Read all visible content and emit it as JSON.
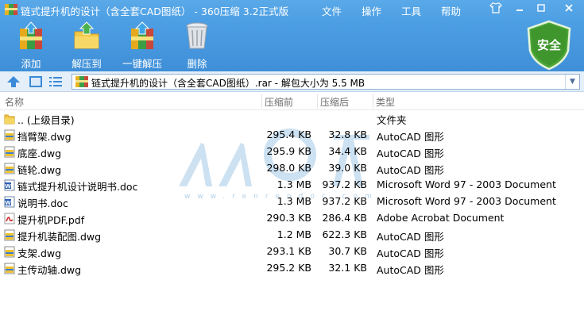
{
  "window": {
    "title": "链式提升机的设计（含全套CAD图纸） - 360压缩 3.2正式版",
    "controls": [
      "shirt-icon",
      "minimize-icon",
      "maximize-icon",
      "close-icon"
    ]
  },
  "menu": {
    "file": "文件",
    "operate": "操作",
    "tools": "工具",
    "help": "帮助"
  },
  "toolbar": {
    "add": "添加",
    "extract": "解压到",
    "one_click_extract": "一键解压",
    "delete": "删除",
    "safety_badge": "安全"
  },
  "addressbar": {
    "path": "链式提升机的设计（含全套CAD图纸）.rar - 解包大小为 5.5 MB"
  },
  "columns": {
    "name": "名称",
    "size_before": "压缩前",
    "size_after": "压缩后",
    "type": "类型"
  },
  "watermark": {
    "url": "www.renrendoc.com"
  },
  "files": [
    {
      "icon": "folder-up-icon",
      "name": ".. (上级目录)",
      "before": "",
      "after": "",
      "type": "文件夹"
    },
    {
      "icon": "dwg-file-icon",
      "name": "挡臂架.dwg",
      "before": "295.4 KB",
      "after": "32.8 KB",
      "type": "AutoCAD 图形"
    },
    {
      "icon": "dwg-file-icon",
      "name": "底座.dwg",
      "before": "295.9 KB",
      "after": "34.4 KB",
      "type": "AutoCAD 图形"
    },
    {
      "icon": "dwg-file-icon",
      "name": "链轮.dwg",
      "before": "298.0 KB",
      "after": "39.0 KB",
      "type": "AutoCAD 图形"
    },
    {
      "icon": "word-file-icon",
      "name": "链式提升机设计说明书.doc",
      "before": "1.3 MB",
      "after": "937.2 KB",
      "type": "Microsoft Word 97 - 2003 Document"
    },
    {
      "icon": "word-file-icon",
      "name": "说明书.doc",
      "before": "1.3 MB",
      "after": "937.2 KB",
      "type": "Microsoft Word 97 - 2003 Document"
    },
    {
      "icon": "pdf-file-icon",
      "name": "提升机PDF.pdf",
      "before": "290.3 KB",
      "after": "286.4 KB",
      "type": "Adobe Acrobat Document"
    },
    {
      "icon": "dwg-file-icon",
      "name": "提升机装配图.dwg",
      "before": "1.2 MB",
      "after": "622.3 KB",
      "type": "AutoCAD 图形"
    },
    {
      "icon": "dwg-file-icon",
      "name": "支架.dwg",
      "before": "293.1 KB",
      "after": "30.7 KB",
      "type": "AutoCAD 图形"
    },
    {
      "icon": "dwg-file-icon",
      "name": "主传动轴.dwg",
      "before": "295.2 KB",
      "after": "32.1 KB",
      "type": "AutoCAD 图形"
    }
  ]
}
